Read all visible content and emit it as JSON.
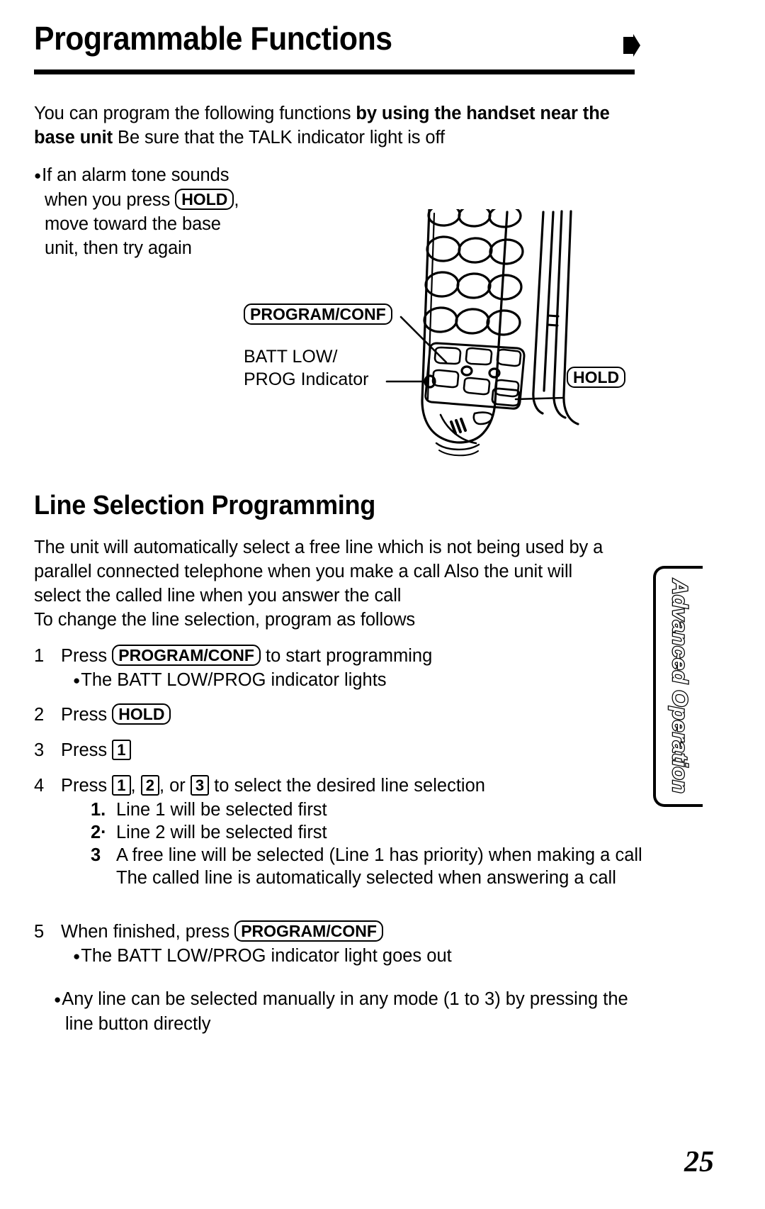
{
  "page": {
    "title": "Programmable Functions",
    "number": "25",
    "side_tab": "Advanced Operation",
    "header_arrow_icon": "right-arrow-icon"
  },
  "intro": {
    "part1": "You can program the following functions ",
    "bold1": "by using the handset near the base unit",
    "part2": "  Be sure that the TALK indicator light is off"
  },
  "alarm_note": {
    "line1": "If an alarm tone sounds",
    "line2_pre": "when you press ",
    "line2_key": "HOLD",
    "line2_post": ",",
    "line3": "move toward the base",
    "line4": "unit, then try again"
  },
  "figure": {
    "callout_program": "PROGRAM/CONF",
    "callout_batt_line1": "BATT LOW/",
    "callout_batt_line2": "PROG Indicator",
    "callout_hold": "HOLD",
    "handset_icon": "cordless-handset-illustration"
  },
  "section": {
    "heading": "Line Selection Programming",
    "para_line1": "The unit will automatically select a free line which is not being used by a",
    "para_line2": "parallel connected telephone when you make a call  Also the unit will",
    "para_line3": "select the called line when you answer the call",
    "para_line4": "To change the line selection, program as follows"
  },
  "steps": [
    {
      "num": "1",
      "pre": "Press ",
      "key": "PROGRAM/CONF",
      "post": " to start programming",
      "sub": "The BATT LOW/PROG indicator lights"
    },
    {
      "num": "2",
      "pre": "Press ",
      "key": "HOLD",
      "post": "",
      "sub": ""
    },
    {
      "num": "3",
      "pre": "Press ",
      "key": "1",
      "post": "",
      "sub": ""
    }
  ],
  "step4": {
    "num": "4",
    "pre": "Press ",
    "key1": "1",
    "sep1": ", ",
    "key2": "2",
    "sep2": ", or ",
    "key3": "3",
    "post": " to select the desired line selection"
  },
  "options": [
    {
      "num": "1.",
      "text": "Line 1 will be selected first"
    },
    {
      "num": "2·",
      "text": "Line 2 will be selected first"
    },
    {
      "num": "3",
      "text": "A free line will be selected (Line 1 has priority) when making a call  The called line is automatically selected when answering a call"
    }
  ],
  "step5": {
    "num": "5",
    "pre": "When finished, press ",
    "key": "PROGRAM/CONF",
    "sub": "The BATT LOW/PROG indicator light goes out"
  },
  "final_note": "Any line can be selected manually in any mode (1 to 3) by pressing the line button directly"
}
